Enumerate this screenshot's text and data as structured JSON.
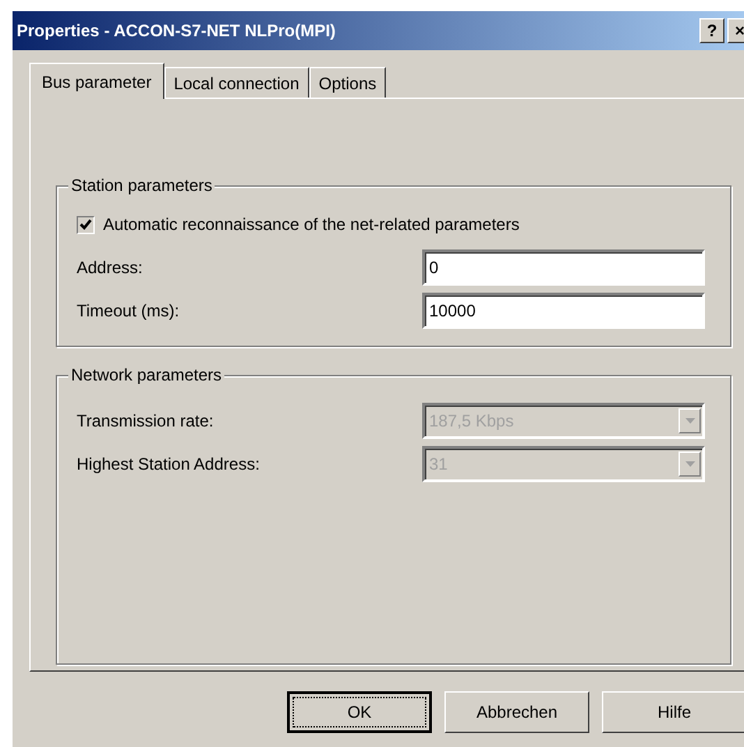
{
  "window": {
    "title": "Properties - ACCON-S7-NET NLPro(MPI)",
    "help_button": "?",
    "close_button": "×"
  },
  "tabs": [
    {
      "label": "Bus parameter",
      "selected": true
    },
    {
      "label": "Local connection",
      "selected": false
    },
    {
      "label": "Options",
      "selected": false
    }
  ],
  "groups": [
    {
      "title": "Station parameters",
      "checkbox": {
        "label": "Automatic reconnaissance of the net-related parameters",
        "checked": true
      },
      "fields": [
        {
          "kind": "text",
          "label": "Address:",
          "value": "0",
          "disabled": false
        },
        {
          "kind": "text",
          "label": "Timeout (ms):",
          "value": "10000",
          "disabled": false
        }
      ]
    },
    {
      "title": "Network parameters",
      "fields": [
        {
          "kind": "dropdown",
          "label": "Transmission rate:",
          "value": "187,5 Kbps",
          "disabled": true
        },
        {
          "kind": "dropdown",
          "label": "Highest Station Address:",
          "value": "31",
          "disabled": true
        }
      ]
    }
  ],
  "buttons": [
    {
      "label": "OK",
      "focused": true
    },
    {
      "label": "Abbrechen",
      "focused": false
    },
    {
      "label": "Hilfe",
      "focused": false
    }
  ]
}
